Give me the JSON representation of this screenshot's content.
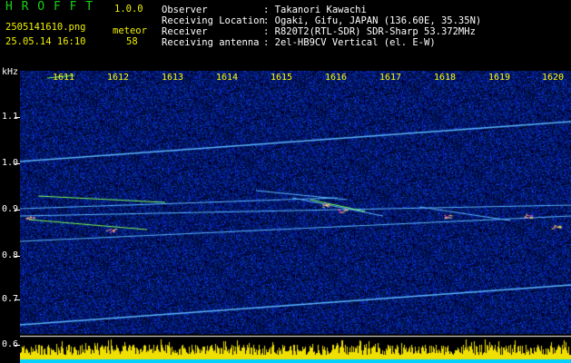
{
  "header": {
    "app_title": "H R O F F T",
    "version": "1.0.0",
    "filename": "2505141610.png",
    "datetime": "25.05.14 16:10",
    "meteor_label": "meteor",
    "meteor_count": "58",
    "observer_label": "Observer",
    "observer_value": ": Takanori Kawachi",
    "location_label": "Receiving Location",
    "location_value": ": Ogaki, Gifu, JAPAN (136.60E, 35.35N)",
    "receiver_label": "Receiver",
    "receiver_value": ": R820T2(RTL-SDR) SDR-Sharp 53.372MHz",
    "antenna_label": "Receiving antenna",
    "antenna_value": ": 2el-HB9CV Vertical (el. E-W)"
  },
  "axis": {
    "unit": "kHz",
    "y_labels": [
      "1.1",
      "1.0",
      "0.9",
      "0.8",
      "0.7",
      "0.6"
    ],
    "minute_labels": [
      "1611",
      "1612",
      "1613",
      "1614",
      "1615",
      "1616",
      "1617",
      "1618",
      "1619",
      "1620"
    ]
  },
  "colors": {
    "background": "#000000",
    "noise": "#1428a0",
    "trace": "#5ab4ff",
    "meteor": "#7cff60",
    "amplitude": "#f0e000",
    "baseline": "#00d0ff"
  }
}
